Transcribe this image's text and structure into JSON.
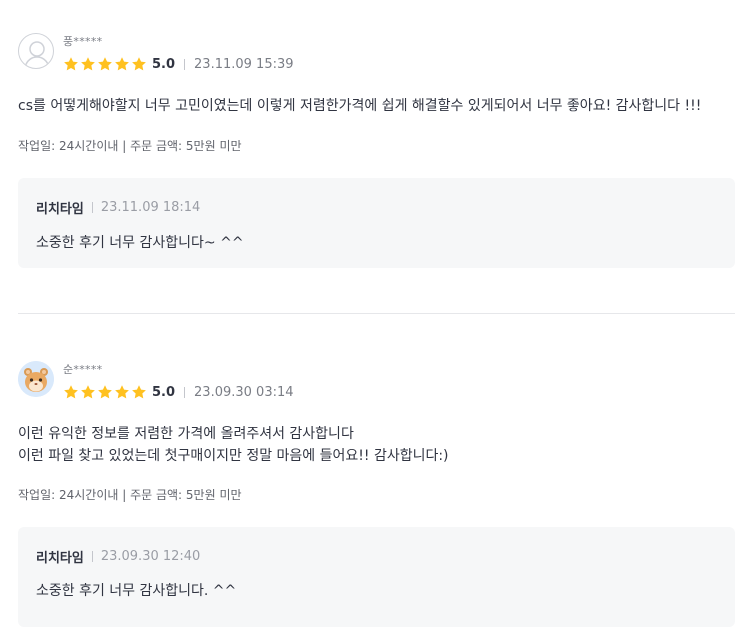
{
  "reviews": [
    {
      "nickname": "풍*****",
      "avatar": "default-avatar-icon",
      "score": "5.0",
      "date": "23.11.09 15:39",
      "content": "cs를 어떻게해야할지 너무 고민이였는데 이렇게 저렴한가격에 쉽게 해결할수 있게되어서 너무 좋아요! 감사합니다 !!!",
      "meta": "작업일: 24시간이내 | 주문 금액: 5만원 미만",
      "reply": {
        "name": "리치타임",
        "date": "23.11.09 18:14",
        "text": "소중한 후기 너무 감사합니다~ ^^"
      }
    },
    {
      "nickname": "순*****",
      "avatar": "hamster-avatar-icon",
      "score": "5.0",
      "date": "23.09.30 03:14",
      "content": "이런 유익한 정보를 저렴한 가격에 올려주셔서 감사합니다\n이런 파일 찾고 있었는데 첫구매이지만 정말 마음에 들어요!! 감사합니다:)",
      "meta": "작업일: 24시간이내 | 주문 금액: 5만원 미만",
      "reply": {
        "name": "리치타임",
        "date": "23.09.30 12:40",
        "text": "소중한 후기 너무 감사합니다. ^^"
      }
    }
  ],
  "colors": {
    "star": "#ffc120",
    "text": "#303441",
    "muted": "#7a7d85",
    "reply_bg": "#f6f7f8"
  }
}
